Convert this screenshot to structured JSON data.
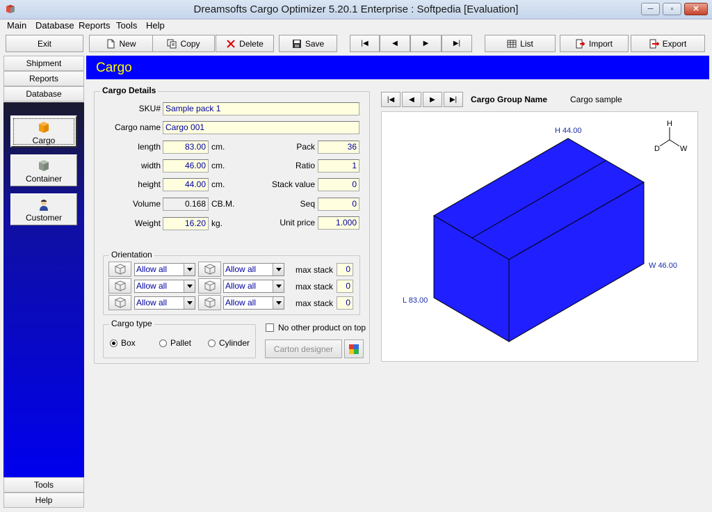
{
  "window": {
    "title": "Dreamsofts Cargo Optimizer 5.20.1 Enterprise : Softpedia [Evaluation]",
    "min_glyph": "─",
    "max_glyph": "▫",
    "close_glyph": "✕"
  },
  "menu": [
    "Main",
    "Database",
    "Reports",
    "Tools",
    "Help"
  ],
  "toolbar": {
    "exit": "Exit",
    "new": "New",
    "copy": "Copy",
    "delete": "Delete",
    "save": "Save",
    "list": "List",
    "import": "Import",
    "export": "Export",
    "nav_first": "|◀",
    "nav_prev": "◀",
    "nav_next": "▶",
    "nav_last": "▶|"
  },
  "sidebar": {
    "top": [
      "Shipment",
      "Reports",
      "Database"
    ],
    "tiles": [
      "Cargo",
      "Container",
      "Customer"
    ],
    "bottom": [
      "Tools",
      "Help"
    ]
  },
  "page": {
    "title": "Cargo"
  },
  "details": {
    "group_title": "Cargo Details",
    "sku_label": "SKU#",
    "sku": "Sample pack 1",
    "name_label": "Cargo name",
    "name": "Cargo 001",
    "length_label": "length",
    "length": "83.00",
    "width_label": "width",
    "width": "46.00",
    "height_label": "height",
    "height": "44.00",
    "volume_label": "Volume",
    "volume": "0.168",
    "weight_label": "Weight",
    "weight": "16.20",
    "unit_cm": "cm.",
    "unit_cbm": "CB.M.",
    "unit_kg": "kg.",
    "pack_label": "Pack",
    "pack": "36",
    "ratio_label": "Ratio",
    "ratio": "1",
    "stack_label": "Stack value",
    "stack": "0",
    "seq_label": "Seq",
    "seq": "0",
    "price_label": "Unit price",
    "price": "1.000"
  },
  "orientation": {
    "title": "Orientation",
    "option": "Allow all",
    "max_label": "max stack",
    "max_values": [
      "0",
      "0",
      "0"
    ]
  },
  "cargo_type": {
    "title": "Cargo type",
    "options": [
      "Box",
      "Pallet",
      "Cylinder"
    ],
    "selected": "Box"
  },
  "no_other_label": "No other product on top",
  "carton_designer": "Carton designer",
  "viewer": {
    "group_label": "Cargo Group Name",
    "group_value": "Cargo sample",
    "label_h": "H 44.00",
    "label_w": "W 46.00",
    "label_l": "L 83.00",
    "axis_h": "H",
    "axis_d": "D",
    "axis_w": "W",
    "box_color": "#1f1fff"
  }
}
